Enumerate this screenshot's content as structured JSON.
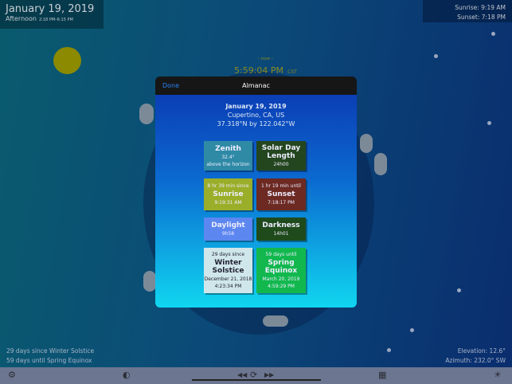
{
  "top_left": {
    "date": "January 19, 2019",
    "period": "Afternoon",
    "period_range": "2:18 PM–6:15 PM"
  },
  "top_right": {
    "sunrise": "Sunrise: 9:19 AM",
    "sunset": "Sunset: 7:18 PM"
  },
  "clock": {
    "now_label": "‹ now ›",
    "time": "5:59:04 PM",
    "tz": "CST"
  },
  "modal": {
    "done": "Done",
    "title": "Almanac",
    "date": "January 19, 2019",
    "location": "Cupertino, CA, US",
    "coords": "37.318°N by 122.042°W",
    "tiles": [
      {
        "top": "",
        "title": "Zenith",
        "sub1": "32.4°",
        "sub2": "above the horizon",
        "color": "#2f8aa6"
      },
      {
        "top": "",
        "title": "Solar Day Length",
        "sub1": "24h00",
        "sub2": "",
        "color": "#24461f"
      },
      {
        "top": "8 hr 39 min since",
        "title": "Sunrise",
        "sub1": "9:19:31 AM",
        "sub2": "",
        "color": "#9aae2a"
      },
      {
        "top": "1 hr 19 min until",
        "title": "Sunset",
        "sub1": "7:18:17 PM",
        "sub2": "",
        "color": "#6c2a22"
      },
      {
        "top": "",
        "title": "Daylight",
        "sub1": "9h58",
        "sub2": "",
        "color": "#5c86f0"
      },
      {
        "top": "",
        "title": "Darkness",
        "sub1": "14h01",
        "sub2": "",
        "color": "#1f4a1c"
      },
      {
        "top": "29 days since",
        "title": "Winter Solstice",
        "sub1": "December 21, 2018",
        "sub2": "4:23:34 PM",
        "color": "#cfe6ea"
      },
      {
        "top": "59 days until",
        "title": "Spring Equinox",
        "sub1": "March 20, 2019",
        "sub2": "4:59:29 PM",
        "color": "#12b84e"
      }
    ]
  },
  "bottom": {
    "solstice": "29 days since Winter Solstice",
    "equinox": "59 days until Spring Equinox",
    "elevation": "Elevation: 12.6°",
    "azimuth": "Azimuth: 232.0° SW"
  },
  "toolbar": {
    "settings": "⚙",
    "contrast": "◐",
    "rewind": "◀◀",
    "refresh": "⟳",
    "forward": "▶▶",
    "grid": "▦",
    "brightness": "☀"
  }
}
